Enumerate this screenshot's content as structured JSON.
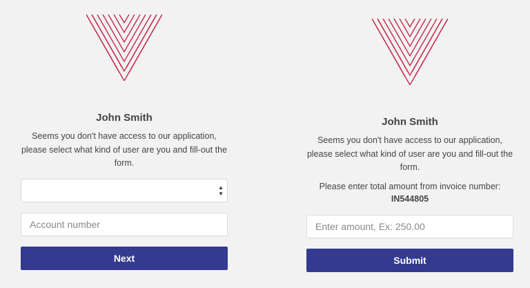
{
  "brand": {
    "logo_icon": "v-stripes-logo-icon",
    "accent_color": "#c21e3f"
  },
  "left": {
    "user_name": "John Smith",
    "message": "Seems you don't have access to our application, please select what kind of user are you and fill-out the form.",
    "user_type_select": {
      "selected": ""
    },
    "account_input": {
      "value": "",
      "placeholder": "Account number"
    },
    "next_label": "Next"
  },
  "right": {
    "user_name": "John Smith",
    "message": "Seems you don't have access to our application, please select what kind of user are you and fill-out the form.",
    "invoice_prompt": "Please enter total amount from invoice number:",
    "invoice_number": "IN544805",
    "amount_input": {
      "value": "",
      "placeholder": "Enter amount, Ex: 250.00"
    },
    "submit_label": "Submit"
  },
  "button_color": "#333a8f"
}
